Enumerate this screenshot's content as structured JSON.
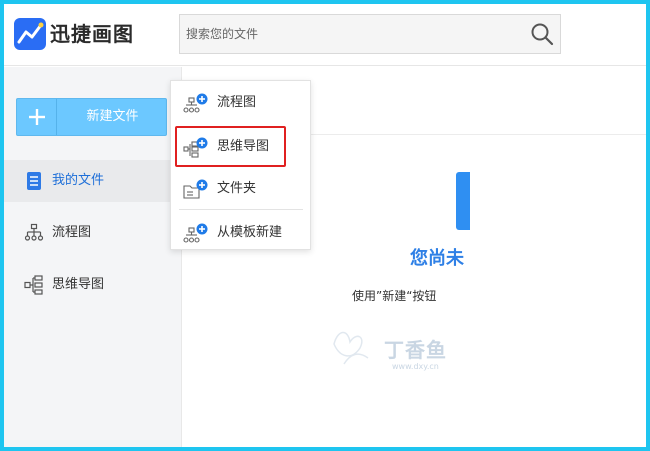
{
  "app": {
    "name": "迅捷画图"
  },
  "search": {
    "placeholder": "搜索您的文件"
  },
  "sidebar": {
    "new_button_label": "新建文件",
    "items": [
      {
        "label": "我的文件",
        "icon": "document-icon",
        "active": true
      },
      {
        "label": "流程图",
        "icon": "flowchart-icon",
        "active": false
      },
      {
        "label": "思维导图",
        "icon": "mindmap-icon",
        "active": false
      }
    ]
  },
  "dropdown": {
    "items": [
      {
        "label": "流程图",
        "icon": "flowchart-add-icon"
      },
      {
        "label": "思维导图",
        "icon": "mindmap-add-icon",
        "highlighted": true
      },
      {
        "label": "文件夹",
        "icon": "folder-add-icon"
      },
      {
        "label": "从模板新建",
        "icon": "template-add-icon"
      }
    ]
  },
  "content": {
    "empty_title": "您尚未",
    "empty_hint": "使用”新建“按钮"
  },
  "watermark": {
    "text": "丁香鱼",
    "sub": "www.dxy.cn"
  },
  "colors": {
    "accent": "#2f80e6",
    "new_button": "#6cc8ff",
    "highlight": "#e02020",
    "frame": "#1ec5f0"
  }
}
